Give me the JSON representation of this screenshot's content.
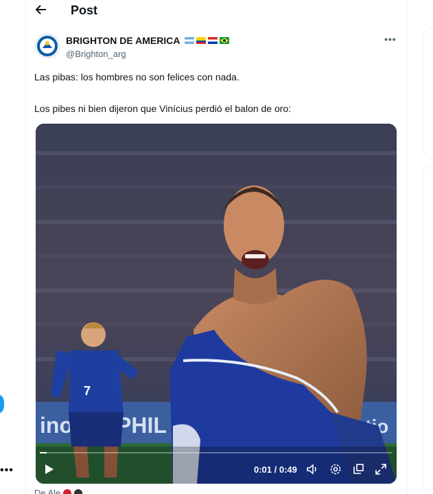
{
  "header": {
    "title": "Post"
  },
  "author": {
    "name": "BRIGHTON DE AMERICA",
    "handle": "@Brighton_arg",
    "flags": [
      "argentina-flag",
      "ecuador-flag",
      "paraguay-flag",
      "brazil-flag"
    ]
  },
  "tweet": {
    "line1": "Las pibas: los hombres no son felices con nada.",
    "line2": "Los pibes ni bien dijeron que Vinícius perdió el balon de oro:"
  },
  "video": {
    "time": "0:01 / 0:49",
    "progress": 0.02,
    "banner_text_left": "inor",
    "banner_text_mid": "PHIL",
    "banner_text_right": "tio",
    "jersey_number": "7"
  },
  "footer": {
    "partial_text": "De Ale"
  },
  "icons": {
    "back": "back-arrow-icon",
    "more": "more-options-icon",
    "play": "play-icon",
    "volume": "volume-icon",
    "settings": "settings-gear-icon",
    "pip": "picture-in-picture-icon",
    "fullscreen": "fullscreen-icon"
  },
  "colors": {
    "accent": "#1d9bf0",
    "text": "#0f1419",
    "secondary_text": "#536471"
  }
}
